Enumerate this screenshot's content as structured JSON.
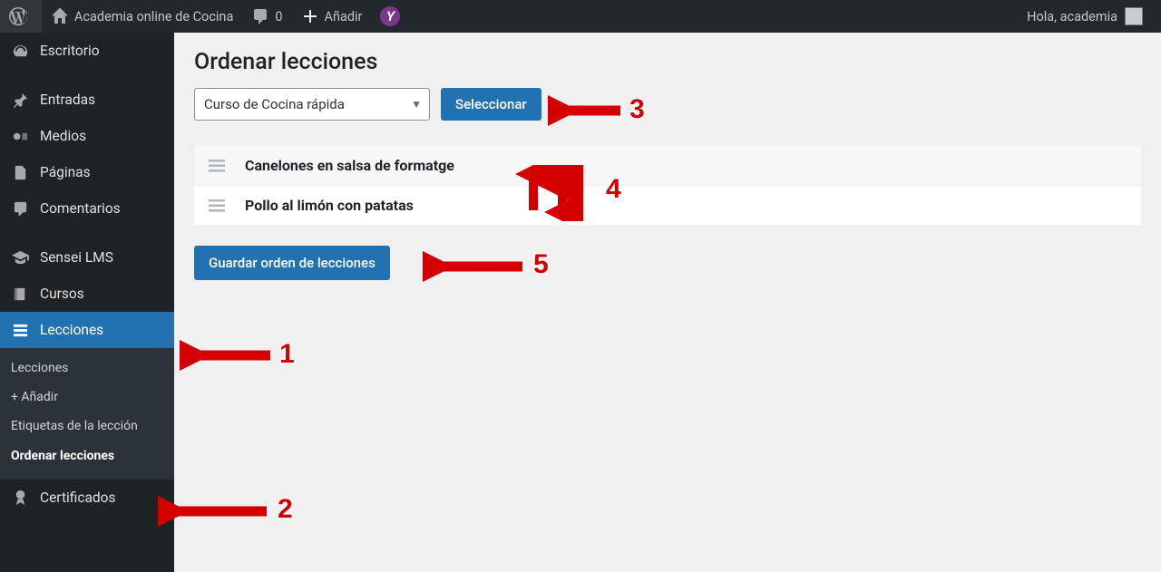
{
  "adminbar": {
    "site_title": "Academia online de Cocina",
    "comments_count": "0",
    "add_new_label": "Añadir",
    "yoast_glyph": "Y",
    "greeting": "Hola, academia"
  },
  "sidebar": {
    "items": [
      {
        "label": "Escritorio"
      },
      {
        "label": "Entradas"
      },
      {
        "label": "Medios"
      },
      {
        "label": "Páginas"
      },
      {
        "label": "Comentarios"
      },
      {
        "label": "Sensei LMS"
      },
      {
        "label": "Cursos"
      },
      {
        "label": "Lecciones"
      },
      {
        "label": "Certificados"
      }
    ],
    "submenu": {
      "items": [
        {
          "label": "Lecciones"
        },
        {
          "label": "+ Añadir"
        },
        {
          "label": "Etiquetas de la lección"
        },
        {
          "label": "Ordenar lecciones"
        }
      ]
    }
  },
  "page": {
    "title": "Ordenar lecciones",
    "selected_course": "Curso de Cocina rápida",
    "select_button": "Seleccionar",
    "lessons": [
      {
        "title": "Canelones en salsa de formatge"
      },
      {
        "title": "Pollo al limón con patatas"
      }
    ],
    "save_button": "Guardar orden de lecciones"
  },
  "annotations": {
    "a1": "1",
    "a2": "2",
    "a3": "3",
    "a4": "4",
    "a5": "5"
  }
}
